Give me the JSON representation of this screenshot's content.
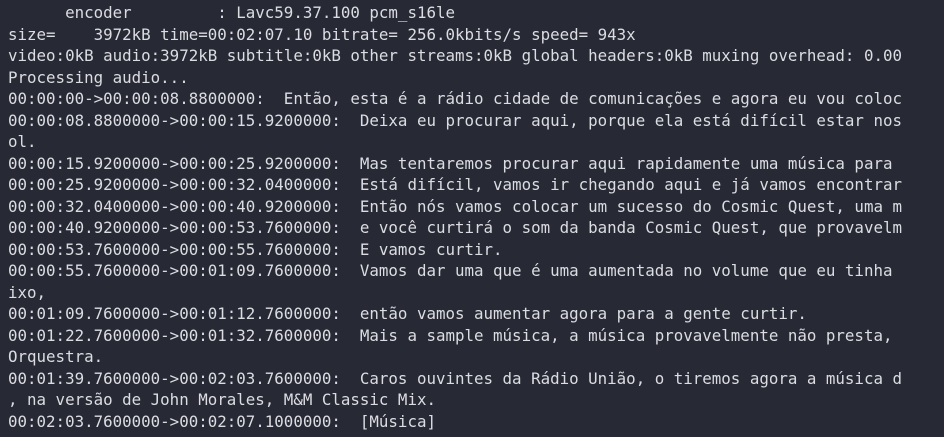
{
  "terminal": {
    "lines": [
      "      encoder         : Lavc59.37.100 pcm_s16le",
      "size=    3972kB time=00:02:07.10 bitrate= 256.0kbits/s speed= 943x",
      "video:0kB audio:3972kB subtitle:0kB other streams:0kB global headers:0kB muxing overhead: 0.00",
      "Processing audio...",
      "00:00:00->00:00:08.8800000:  Então, esta é a rádio cidade de comunicações e agora eu vou coloc",
      "00:00:08.8800000->00:00:15.9200000:  Deixa eu procurar aqui, porque ela está difícil estar nos",
      "ol.",
      "00:00:15.9200000->00:00:25.9200000:  Mas tentaremos procurar aqui rapidamente uma música para",
      "00:00:25.9200000->00:00:32.0400000:  Está difícil, vamos ir chegando aqui e já vamos encontrar",
      "00:00:32.0400000->00:00:40.9200000:  Então nós vamos colocar um sucesso do Cosmic Quest, uma m",
      "00:00:40.9200000->00:00:53.7600000:  e você curtirá o som da banda Cosmic Quest, que provavelm",
      "00:00:53.7600000->00:00:55.7600000:  E vamos curtir.",
      "00:00:55.7600000->00:01:09.7600000:  Vamos dar uma que é uma aumentada no volume que eu tinha",
      "ixo,",
      "00:01:09.7600000->00:01:12.7600000:  então vamos aumentar agora para a gente curtir.",
      "00:01:22.7600000->00:01:32.7600000:  Mais a sample música, a música provavelmente não presta,",
      "Orquestra.",
      "00:01:39.7600000->00:02:03.7600000:  Caros ouvintes da Rádio União, o tiremos agora a música d",
      ", na versão de John Morales, M&M Classic Mix.",
      "00:02:03.7600000->00:02:07.1000000:  [Música]"
    ]
  },
  "colors": {
    "background": "#272935",
    "text": "#dcdde2"
  }
}
